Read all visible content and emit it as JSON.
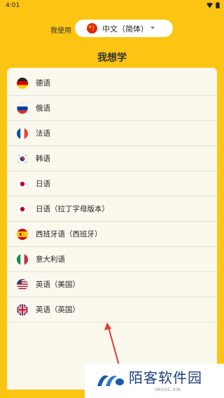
{
  "status_bar": {
    "time": "4:01"
  },
  "my_language": {
    "label": "我使用",
    "selected": "中文（简体）",
    "flag_icon": "flag-china-icon"
  },
  "section_title": "我想学",
  "languages": [
    {
      "label": "德语",
      "flag_icon": "flag-germany-icon"
    },
    {
      "label": "俄语",
      "flag_icon": "flag-russia-icon"
    },
    {
      "label": "法语",
      "flag_icon": "flag-france-icon"
    },
    {
      "label": "韩语",
      "flag_icon": "flag-korea-icon"
    },
    {
      "label": "日语",
      "flag_icon": "flag-japan-icon"
    },
    {
      "label": "日语（拉丁字母版本）",
      "flag_icon": "flag-japan-icon"
    },
    {
      "label": "西班牙语（西班牙）",
      "flag_icon": "flag-spain-icon"
    },
    {
      "label": "意大利语",
      "flag_icon": "flag-italy-icon"
    },
    {
      "label": "英语（美国）",
      "flag_icon": "flag-usa-icon"
    },
    {
      "label": "英语（英国）",
      "flag_icon": "flag-uk-icon"
    }
  ],
  "watermark": {
    "title": "陌客软件园",
    "subtitle": "IMOOC.XIN"
  },
  "colors": {
    "background": "#FDC513",
    "card": "#FBF9EE",
    "arrow": "#E53935",
    "watermark_text": "#1E3F7A"
  }
}
